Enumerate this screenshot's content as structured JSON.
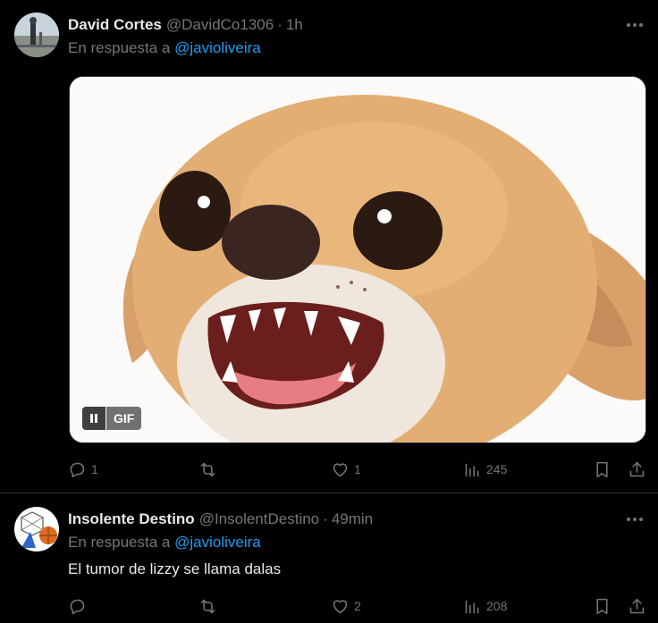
{
  "tweets": [
    {
      "name": "David Cortes",
      "handle": "@DavidCo1306",
      "separator": "·",
      "time": "1h",
      "reply_prefix": "En respuesta a",
      "reply_to": "@javioliveira",
      "media": {
        "type": "gif",
        "badge": "GIF"
      },
      "stats": {
        "replies": "1",
        "retweets": "",
        "likes": "1",
        "views": "245"
      }
    },
    {
      "name": "Insolente Destino",
      "handle": "@InsolentDestino",
      "separator": "·",
      "time": "49min",
      "reply_prefix": "En respuesta a",
      "reply_to": "@javioliveira",
      "text": "El tumor de lizzy se llama dalas",
      "stats": {
        "replies": "",
        "retweets": "",
        "likes": "2",
        "views": "208"
      }
    }
  ],
  "colors": {
    "background": "#000000",
    "text": "#e7e9ea",
    "muted": "#71767b",
    "accent": "#1d9bf0",
    "divider": "#2f3336"
  },
  "icons": [
    "more-icon",
    "reply-icon",
    "retweet-icon",
    "like-icon",
    "views-icon",
    "bookmark-icon",
    "share-icon",
    "pause-icon"
  ]
}
